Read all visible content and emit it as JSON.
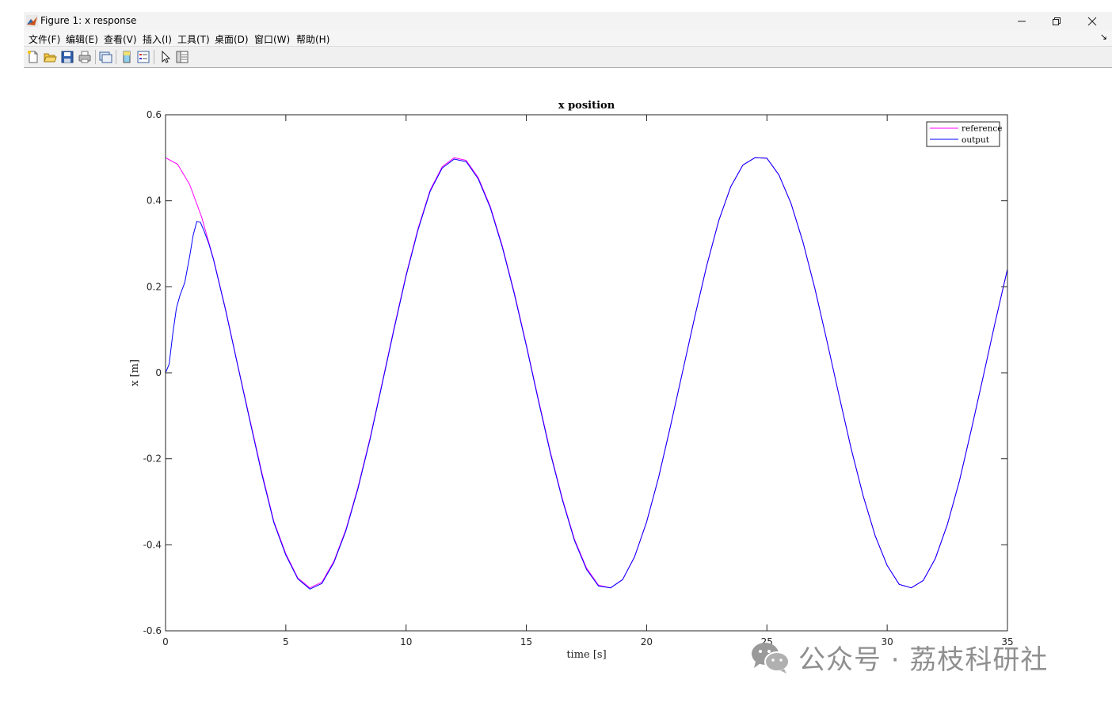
{
  "window": {
    "title": "Figure 1: x response",
    "controls": {
      "minimize": "—",
      "maximize": "❐",
      "close": "✕"
    }
  },
  "menu": [
    {
      "label": "文件(F)"
    },
    {
      "label": "编辑(E)"
    },
    {
      "label": "查看(V)"
    },
    {
      "label": "插入(I)"
    },
    {
      "label": "工具(T)"
    },
    {
      "label": "桌面(D)"
    },
    {
      "label": "窗口(W)"
    },
    {
      "label": "帮助(H)"
    }
  ],
  "menu_dock_arrow": "↘",
  "toolbar": {
    "buttons": [
      "new-figure-icon",
      "open-file-icon",
      "save-icon",
      "print-icon",
      "link-plot-icon",
      "colorbar-icon",
      "legend-icon",
      "pointer-icon",
      "property-inspector-icon"
    ]
  },
  "watermark": {
    "text": "公众号 · 荔枝科研社"
  },
  "chart_data": {
    "type": "line",
    "title": "x position",
    "xlabel": "time [s]",
    "ylabel": "x [m]",
    "xlim": [
      0,
      35
    ],
    "ylim": [
      -0.6,
      0.6
    ],
    "xticks": [
      0,
      5,
      10,
      15,
      20,
      25,
      30,
      35
    ],
    "yticks": [
      -0.6,
      -0.4,
      -0.2,
      0,
      0.2,
      0.4,
      0.6
    ],
    "xtick_labels": [
      "0",
      "5",
      "10",
      "15",
      "20",
      "25",
      "30",
      "35"
    ],
    "ytick_labels": [
      "-0.6",
      "-0.4",
      "-0.2",
      "0",
      "0.2",
      "0.4",
      "0.6"
    ],
    "legend_position": "top-right",
    "grid": false,
    "series": [
      {
        "name": "reference",
        "color": "#ff00ff",
        "x": [
          0,
          0.5,
          1,
          1.5,
          2,
          2.5,
          3,
          3.5,
          4,
          4.5,
          5,
          5.5,
          6,
          6.5,
          7,
          7.5,
          8,
          8.5,
          9,
          9.5,
          10,
          10.5,
          11,
          11.5,
          12,
          12.5,
          13,
          13.5,
          14,
          14.5,
          15,
          15.5,
          16,
          16.5,
          17,
          17.5,
          18,
          18.5,
          19,
          19.5,
          20,
          20.5,
          21,
          21.5,
          22,
          22.5,
          23,
          23.5,
          24,
          24.5,
          25,
          25.5,
          26,
          26.5,
          27,
          27.5,
          28,
          28.5,
          29,
          29.5,
          30,
          30.5,
          31,
          31.5,
          32,
          32.5,
          33,
          33.5,
          34,
          34.5,
          35
        ],
        "y": [
          0.5,
          0.485,
          0.438,
          0.362,
          0.264,
          0.147,
          0.019,
          -0.107,
          -0.231,
          -0.345,
          -0.421,
          -0.477,
          -0.5,
          -0.487,
          -0.438,
          -0.364,
          -0.266,
          -0.152,
          -0.025,
          0.104,
          0.228,
          0.336,
          0.425,
          0.479,
          0.5,
          0.494,
          0.454,
          0.387,
          0.295,
          0.186,
          0.065,
          -0.062,
          -0.184,
          -0.293,
          -0.387,
          -0.454,
          -0.494,
          -0.5,
          -0.481,
          -0.428,
          -0.347,
          -0.243,
          -0.122,
          0.004,
          0.13,
          0.25,
          0.354,
          0.433,
          0.483,
          0.5,
          0.499,
          0.46,
          0.394,
          0.304,
          0.195,
          0.073,
          -0.053,
          -0.176,
          -0.286,
          -0.379,
          -0.448,
          -0.492,
          -0.5,
          -0.483,
          -0.432,
          -0.353,
          -0.252,
          -0.132,
          -0.007,
          0.12,
          0.241
        ]
      },
      {
        "name": "output",
        "color": "#0000ff",
        "x": [
          0,
          0.15,
          0.3,
          0.45,
          0.6,
          0.8,
          1,
          1.15,
          1.3,
          1.45,
          1.6,
          1.8,
          2,
          2.5,
          3,
          3.5,
          4,
          4.5,
          5,
          5.5,
          6,
          6.5,
          7,
          7.5,
          8,
          8.5,
          9,
          9.5,
          10,
          10.5,
          11,
          11.5,
          12,
          12.5,
          13,
          13.5,
          14,
          14.5,
          15,
          15.5,
          16,
          16.5,
          17,
          17.5,
          18,
          18.5,
          19,
          19.5,
          20,
          20.5,
          21,
          21.5,
          22,
          22.5,
          23,
          23.5,
          24,
          24.5,
          25,
          25.5,
          26,
          26.5,
          27,
          27.5,
          28,
          28.5,
          29,
          29.5,
          30,
          30.5,
          31,
          31.5,
          32,
          32.5,
          33,
          33.5,
          34,
          34.5,
          35
        ],
        "y": [
          0,
          0.02,
          0.09,
          0.15,
          0.18,
          0.21,
          0.27,
          0.32,
          0.352,
          0.35,
          0.33,
          0.3,
          0.262,
          0.145,
          0.017,
          -0.11,
          -0.235,
          -0.348,
          -0.424,
          -0.479,
          -0.503,
          -0.49,
          -0.441,
          -0.367,
          -0.269,
          -0.155,
          -0.028,
          0.101,
          0.225,
          0.333,
          0.422,
          0.476,
          0.497,
          0.491,
          0.451,
          0.384,
          0.292,
          0.183,
          0.062,
          -0.065,
          -0.187,
          -0.296,
          -0.39,
          -0.457,
          -0.496,
          -0.5,
          -0.481,
          -0.428,
          -0.347,
          -0.243,
          -0.122,
          0.004,
          0.13,
          0.25,
          0.354,
          0.433,
          0.483,
          0.5,
          0.499,
          0.46,
          0.394,
          0.304,
          0.195,
          0.073,
          -0.053,
          -0.176,
          -0.286,
          -0.379,
          -0.448,
          -0.492,
          -0.5,
          -0.483,
          -0.432,
          -0.353,
          -0.252,
          -0.132,
          -0.007,
          0.12,
          0.241
        ]
      }
    ]
  }
}
